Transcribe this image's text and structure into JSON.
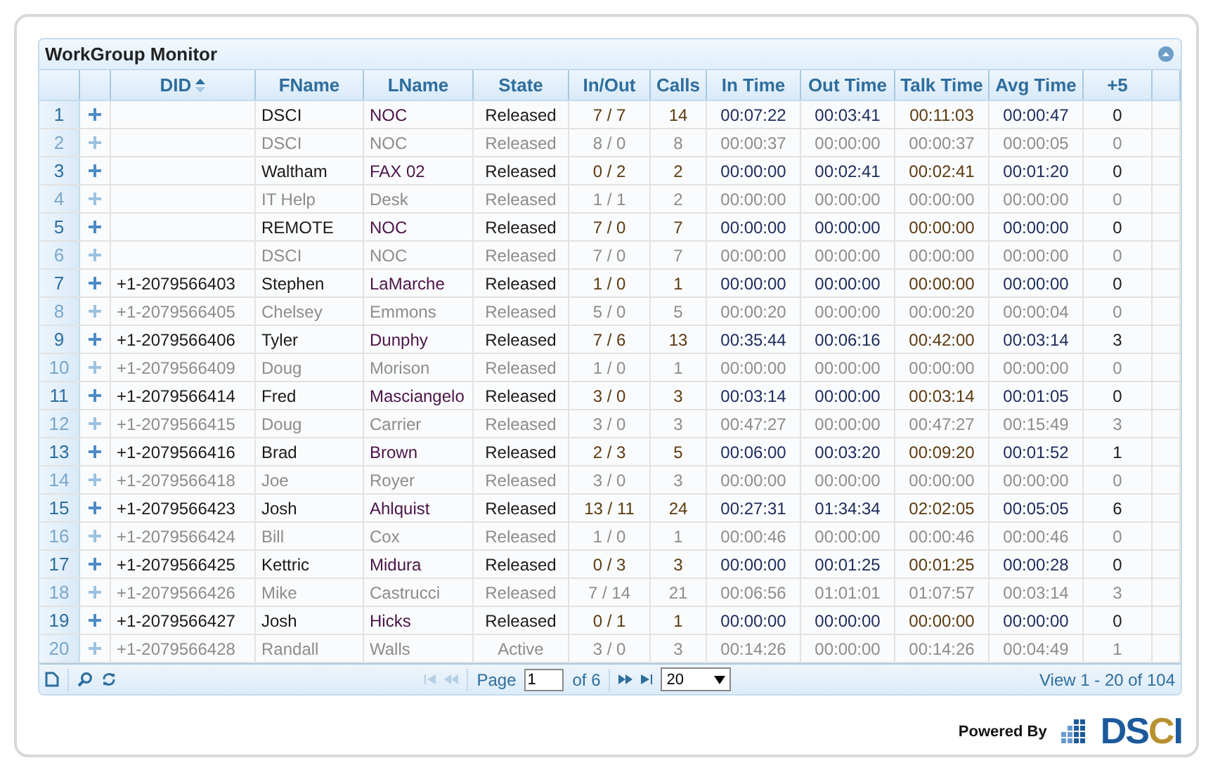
{
  "panel": {
    "title": "WorkGroup Monitor"
  },
  "columns": [
    {
      "label": "DID",
      "sorted": true
    },
    {
      "label": "FName",
      "sorted": false
    },
    {
      "label": "LName",
      "sorted": false
    },
    {
      "label": "State",
      "sorted": false
    },
    {
      "label": "In/Out",
      "sorted": false
    },
    {
      "label": "Calls",
      "sorted": false
    },
    {
      "label": "In Time",
      "sorted": false
    },
    {
      "label": "Out Time",
      "sorted": false
    },
    {
      "label": "Talk Time",
      "sorted": false
    },
    {
      "label": "Avg Time",
      "sorted": false
    },
    {
      "label": "+5",
      "sorted": false
    }
  ],
  "rows": [
    {
      "number": "1",
      "dimmed": false,
      "cells": [
        "DSCI",
        "NOC",
        "Released",
        "7 / 7",
        "14",
        "00:07:22",
        "00:03:41",
        "00:11:03",
        "00:00:47",
        "0"
      ]
    },
    {
      "number": "2",
      "dimmed": true,
      "cells": [
        "DSCI",
        "NOC",
        "Released",
        "8 / 0",
        "8",
        "00:00:37",
        "00:00:00",
        "00:00:37",
        "00:00:05",
        "0"
      ]
    },
    {
      "number": "3",
      "dimmed": false,
      "cells": [
        "Waltham",
        "FAX 02",
        "Released",
        "0 / 2",
        "2",
        "00:00:00",
        "00:02:41",
        "00:02:41",
        "00:01:20",
        "0"
      ]
    },
    {
      "number": "4",
      "dimmed": true,
      "cells": [
        "IT Help",
        "Desk",
        "Released",
        "1 / 1",
        "2",
        "00:00:00",
        "00:00:00",
        "00:00:00",
        "00:00:00",
        "0"
      ]
    },
    {
      "number": "5",
      "dimmed": false,
      "cells": [
        "REMOTE",
        "NOC",
        "Released",
        "7 / 0",
        "7",
        "00:00:00",
        "00:00:00",
        "00:00:00",
        "00:00:00",
        "0"
      ]
    },
    {
      "number": "6",
      "dimmed": true,
      "cells": [
        "DSCI",
        "NOC",
        "Released",
        "7 / 0",
        "7",
        "00:00:00",
        "00:00:00",
        "00:00:00",
        "00:00:00",
        "0"
      ]
    },
    {
      "number": "7",
      "dimmed": false,
      "did": "+1-2079566403",
      "cells": [
        "Stephen",
        "LaMarche",
        "Released",
        "1 / 0",
        "1",
        "00:00:00",
        "00:00:00",
        "00:00:00",
        "00:00:00",
        "0"
      ]
    },
    {
      "number": "8",
      "dimmed": true,
      "did": "+1-2079566405",
      "cells": [
        "Chelsey",
        "Emmons",
        "Released",
        "5 / 0",
        "5",
        "00:00:20",
        "00:00:00",
        "00:00:20",
        "00:00:04",
        "0"
      ]
    },
    {
      "number": "9",
      "dimmed": false,
      "did": "+1-2079566406",
      "cells": [
        "Tyler",
        "Dunphy",
        "Released",
        "7 / 6",
        "13",
        "00:35:44",
        "00:06:16",
        "00:42:00",
        "00:03:14",
        "3"
      ]
    },
    {
      "number": "10",
      "dimmed": true,
      "did": "+1-2079566409",
      "cells": [
        "Doug",
        "Morison",
        "Released",
        "1 / 0",
        "1",
        "00:00:00",
        "00:00:00",
        "00:00:00",
        "00:00:00",
        "0"
      ]
    },
    {
      "number": "11",
      "dimmed": false,
      "did": "+1-2079566414",
      "cells": [
        "Fred",
        "Masciangelo",
        "Released",
        "3 / 0",
        "3",
        "00:03:14",
        "00:00:00",
        "00:03:14",
        "00:01:05",
        "0"
      ]
    },
    {
      "number": "12",
      "dimmed": true,
      "did": "+1-2079566415",
      "cells": [
        "Doug",
        "Carrier",
        "Released",
        "3 / 0",
        "3",
        "00:47:27",
        "00:00:00",
        "00:47:27",
        "00:15:49",
        "3"
      ]
    },
    {
      "number": "13",
      "dimmed": false,
      "did": "+1-2079566416",
      "cells": [
        "Brad",
        "Brown",
        "Released",
        "2 / 3",
        "5",
        "00:06:00",
        "00:03:20",
        "00:09:20",
        "00:01:52",
        "1"
      ]
    },
    {
      "number": "14",
      "dimmed": true,
      "did": "+1-2079566418",
      "cells": [
        "Joe",
        "Royer",
        "Released",
        "3 / 0",
        "3",
        "00:00:00",
        "00:00:00",
        "00:00:00",
        "00:00:00",
        "0"
      ]
    },
    {
      "number": "15",
      "dimmed": false,
      "did": "+1-2079566423",
      "cells": [
        "Josh",
        "Ahlquist",
        "Released",
        "13 / 11",
        "24",
        "00:27:31",
        "01:34:34",
        "02:02:05",
        "00:05:05",
        "6"
      ]
    },
    {
      "number": "16",
      "dimmed": true,
      "did": "+1-2079566424",
      "cells": [
        "Bill",
        "Cox",
        "Released",
        "1 / 0",
        "1",
        "00:00:46",
        "00:00:00",
        "00:00:46",
        "00:00:46",
        "0"
      ]
    },
    {
      "number": "17",
      "dimmed": false,
      "did": "+1-2079566425",
      "cells": [
        "Kettric",
        "Midura",
        "Released",
        "0 / 3",
        "3",
        "00:00:00",
        "00:01:25",
        "00:01:25",
        "00:00:28",
        "0"
      ]
    },
    {
      "number": "18",
      "dimmed": true,
      "did": "+1-2079566426",
      "cells": [
        "Mike",
        "Castrucci",
        "Released",
        "7 / 14",
        "21",
        "00:06:56",
        "01:01:01",
        "01:07:57",
        "00:03:14",
        "3"
      ]
    },
    {
      "number": "19",
      "dimmed": false,
      "did": "+1-2079566427",
      "cells": [
        "Josh",
        "Hicks",
        "Released",
        "0 / 1",
        "1",
        "00:00:00",
        "00:00:00",
        "00:00:00",
        "00:00:00",
        "0"
      ]
    },
    {
      "number": "20",
      "dimmed": true,
      "did": "+1-2079566428",
      "cells": [
        "Randall",
        "Walls",
        "Active",
        "3 / 0",
        "3",
        "00:14:26",
        "00:00:00",
        "00:14:26",
        "00:04:49",
        "1"
      ]
    }
  ],
  "pager": {
    "page_label": "Page",
    "page": "1",
    "of_pages": "of 6",
    "page_size": "20",
    "summary": "View 1 - 20 of 104",
    "back_disabled": true,
    "forward_disabled": false
  },
  "footer": {
    "powered_by": "Powered By",
    "logo": "DSCI"
  }
}
